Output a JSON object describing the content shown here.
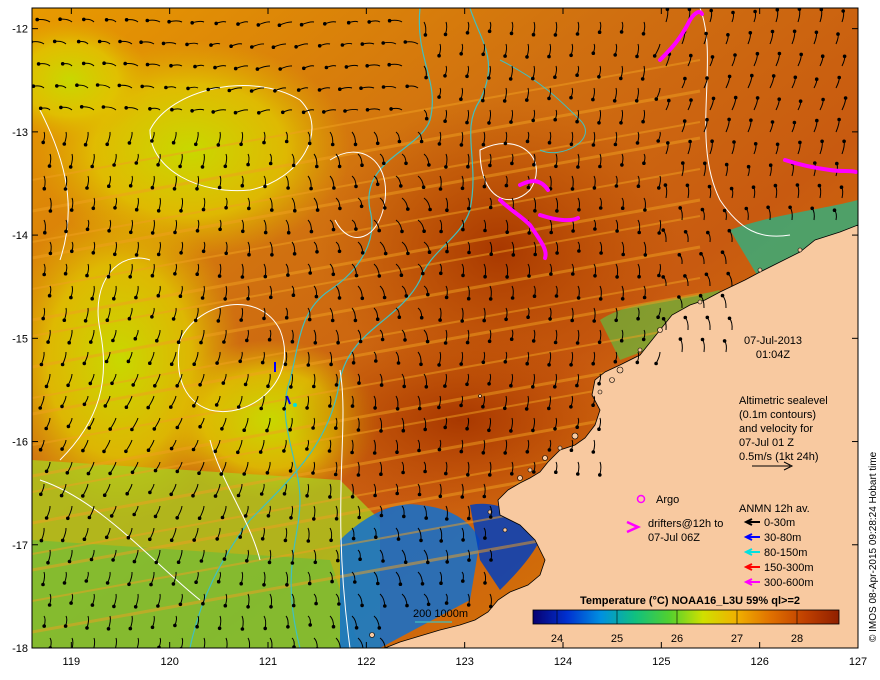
{
  "chart_data": {
    "type": "heatmap",
    "x_ticks": [
      "119",
      "120",
      "121",
      "122",
      "123",
      "124",
      "125",
      "126",
      "127"
    ],
    "y_ticks": [
      "-12",
      "-13",
      "-14",
      "-15",
      "-16",
      "-17",
      "-18"
    ],
    "xlim": [
      118.6,
      127
    ],
    "ylim": [
      -18,
      -11.8
    ],
    "colorbar": {
      "title": "Temperature (°C) NOAA16_L3U 59% ql>=2",
      "ticks": [
        "24",
        "25",
        "26",
        "27",
        "28"
      ],
      "range": [
        23.6,
        28.7
      ],
      "colors": [
        "#080070",
        "#0030d0",
        "#0090e0",
        "#10c080",
        "#50d030",
        "#d0e000",
        "#f0b000",
        "#e07000",
        "#c04000",
        "#902000"
      ]
    },
    "date_label": "07-Jul-2013",
    "time_label": "01:04Z",
    "altimetry_note": [
      "Altimetric sealevel",
      "(0.1m contours)",
      "and velocity for",
      "07-Jul 01 Z",
      "0.5m/s (1kt 24h)"
    ],
    "argo_label": "Argo",
    "drifters_label": [
      "drifters@12h to",
      "07-Jul 06Z"
    ],
    "anmn": {
      "title": "ANMN 12h av.",
      "items": [
        {
          "label": "0-30m",
          "color": "#000000"
        },
        {
          "label": "30-80m",
          "color": "#0000ff"
        },
        {
          "label": "80-150m",
          "color": "#00e0e0"
        },
        {
          "label": "150-300m",
          "color": "#ff0000"
        },
        {
          "label": "300-600m",
          "color": "#ff00ff"
        }
      ]
    },
    "bathy_label": "200  1000m",
    "credit": "© IMOS 08-Apr-2015 09:28:24 Hobart time",
    "land_color": "#f8c9a0",
    "bathy_color": "#40c0c0"
  }
}
